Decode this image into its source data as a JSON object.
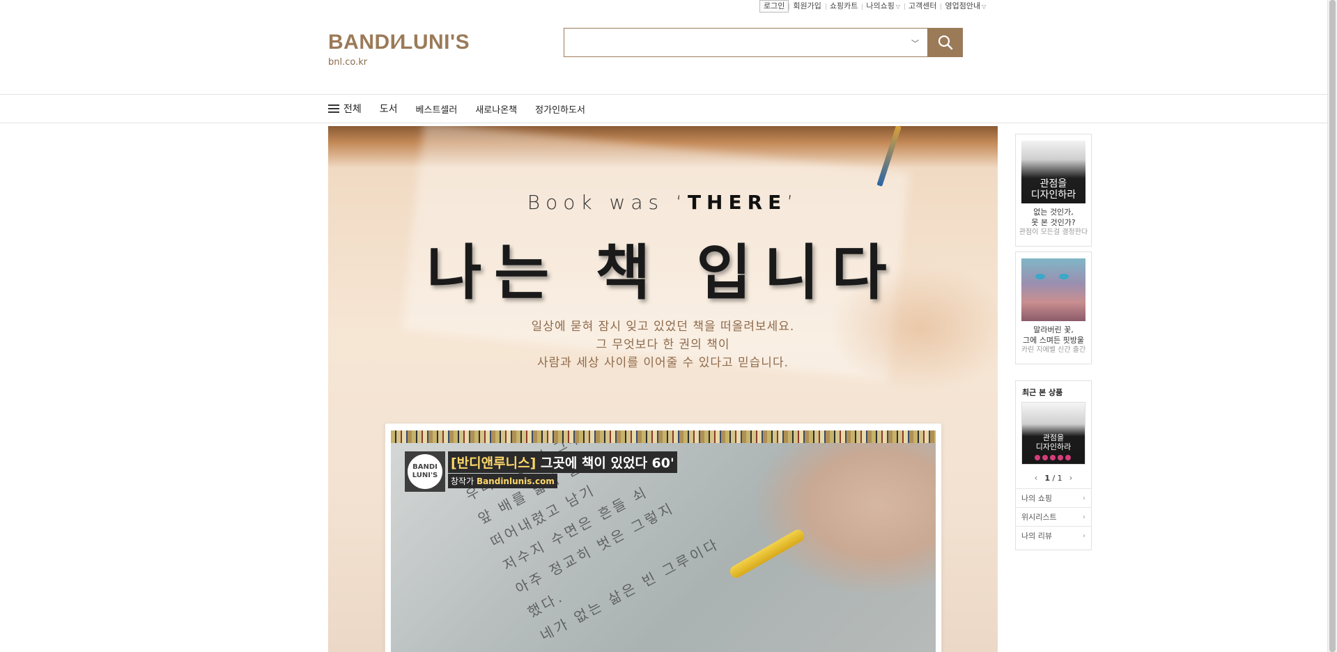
{
  "top_links": [
    {
      "label": "로그인",
      "boxed": true,
      "caret": false
    },
    {
      "label": "회원가입",
      "caret": false
    },
    {
      "label": "쇼핑카트",
      "caret": false
    },
    {
      "label": "나의쇼핑",
      "caret": true
    },
    {
      "label": "고객센터",
      "caret": false
    },
    {
      "label": "영업점안내",
      "caret": true
    }
  ],
  "logo": {
    "name": "BANDI⁄LUNI'S",
    "domain": "bnl.co.kr"
  },
  "search": {
    "value": "",
    "placeholder": ""
  },
  "nav": {
    "all_label": "전체",
    "items": [
      "도서",
      "베스트셀러",
      "새로나온책",
      "정가인하도서"
    ]
  },
  "banner": {
    "tagline_pre": "Book was ‘",
    "tagline_bold": "THERE",
    "tagline_post": "’",
    "headline": "나는 책 입니다",
    "sub_lines": [
      "일상에 묻혀 잠시 잊고 있었던 책을 떠올려보세요.",
      "그 무엇보다 한 권의 책이",
      "사람과 세상 사이를 이어줄 수 있다고 믿습니다."
    ],
    "video": {
      "channel_logo": "BANDI\nLUNI'S",
      "title_bracket": "[반디앤루니스]",
      "title_rest": " 그곳에 책이 있었다 60'",
      "sub_pre": "창작가 ",
      "sub_link": "Bandinlunis.com",
      "page_text": [
        "우리는 텅 빈 그루",
        "앞 배를 밟아 달아",
        "떠어내렸고 남기",
        "저수지 수면은 흔들 쇠",
        "아주 정교히 벗은 그렇지",
        "했다.",
        "네가 없는 삶은 빈 그루이다"
      ]
    }
  },
  "side": {
    "ad1": {
      "cover_title": "관점을\n디자인하라",
      "line1": "없는 것인가,",
      "line2": "못 본 것인가?",
      "line3": "관점이 모든걸 결정한다"
    },
    "ad2": {
      "line1": "말라버린 꽃,",
      "line2": "그에 스며든 핏방울",
      "line3": "카린 지에벨 신간 출간"
    },
    "recent": {
      "title": "최근 본 상품",
      "cover_title": "관점을\n디자인하라",
      "page_current": "1",
      "page_total": "1",
      "page_sep": " / "
    },
    "links": [
      "나의 쇼핑",
      "위시리스트",
      "나의 리뷰"
    ]
  },
  "colors": {
    "brand": "#9b7a58",
    "text": "#333333"
  }
}
